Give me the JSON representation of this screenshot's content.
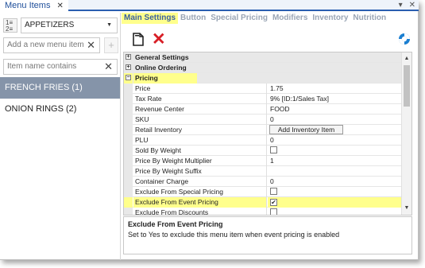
{
  "window": {
    "tab_title": "Menu Items",
    "tab_close": "✕",
    "controls": [
      "▾",
      "✕"
    ]
  },
  "left": {
    "category_select_value": "APPETIZERS",
    "add_placeholder": "Add a new menu item",
    "filter_placeholder": "Item name contains",
    "items": [
      "FRENCH FRIES (1)",
      "ONION RINGS (2)"
    ],
    "selected_item": "FRENCH FRIES (1)"
  },
  "tabs": [
    "Main Settings",
    "Button",
    "Special Pricing",
    "Modifiers",
    "Inventory",
    "Nutrition"
  ],
  "active_tab": "Main Settings",
  "grid": {
    "categories": {
      "general": "General Settings",
      "online": "Online Ordering",
      "pricing": "Pricing"
    },
    "rows": {
      "price": {
        "label": "Price",
        "value": "1.75"
      },
      "tax_rate": {
        "label": "Tax Rate",
        "value": "9% [ID:1/Sales Tax]"
      },
      "revenue_center": {
        "label": "Revenue Center",
        "value": "FOOD"
      },
      "sku": {
        "label": "SKU",
        "value": "0"
      },
      "retail_inventory": {
        "label": "Retail Inventory",
        "button": "Add Inventory Item"
      },
      "plu": {
        "label": "PLU",
        "value": "0"
      },
      "sold_by_weight": {
        "label": "Sold By Weight",
        "checked": false
      },
      "pbw_multiplier": {
        "label": "Price By Weight Multiplier",
        "value": "1"
      },
      "pbw_suffix": {
        "label": "Price By Weight Suffix",
        "value": ""
      },
      "container_charge": {
        "label": "Container Charge",
        "value": "0"
      },
      "excl_special": {
        "label": "Exclude From Special Pricing",
        "checked": false
      },
      "excl_event": {
        "label": "Exclude From Event Pricing",
        "checked": true
      },
      "excl_discounts": {
        "label": "Exclude From Discounts",
        "checked": false
      }
    }
  },
  "description": {
    "title": "Exclude From Event Pricing",
    "text": "Set to Yes to exclude this menu item when event pricing is enabled"
  },
  "colors": {
    "highlight": "#ffff8c",
    "selected_item_bg": "#8594a9",
    "delete_red": "#d81f26",
    "accent_blue": "#2a5eb0"
  }
}
